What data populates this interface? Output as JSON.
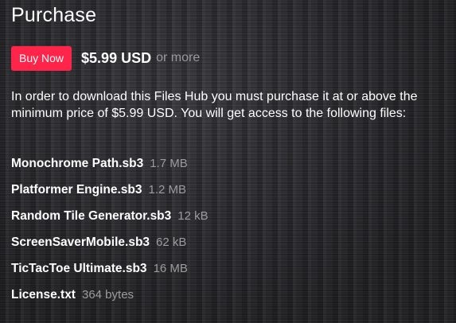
{
  "purchase": {
    "title": "Purchase",
    "buy_button_label": "Buy Now",
    "price": "$5.99 USD",
    "price_suffix": "or more",
    "description": "In order to download this Files Hub you must purchase it at or above the minimum price of $5.99 USD. You will get access to the following files:",
    "button_color": "#ff2449"
  },
  "files": [
    {
      "name": "Monochrome Path.sb3",
      "size": "1.7 MB"
    },
    {
      "name": "Platformer Engine.sb3",
      "size": "1.2 MB"
    },
    {
      "name": "Random Tile Generator.sb3",
      "size": "12 kB"
    },
    {
      "name": "ScreenSaverMobile.sb3",
      "size": "62 kB"
    },
    {
      "name": "TicTacToe Ultimate.sb3",
      "size": "16 MB"
    },
    {
      "name": "License.txt",
      "size": "364 bytes"
    }
  ]
}
